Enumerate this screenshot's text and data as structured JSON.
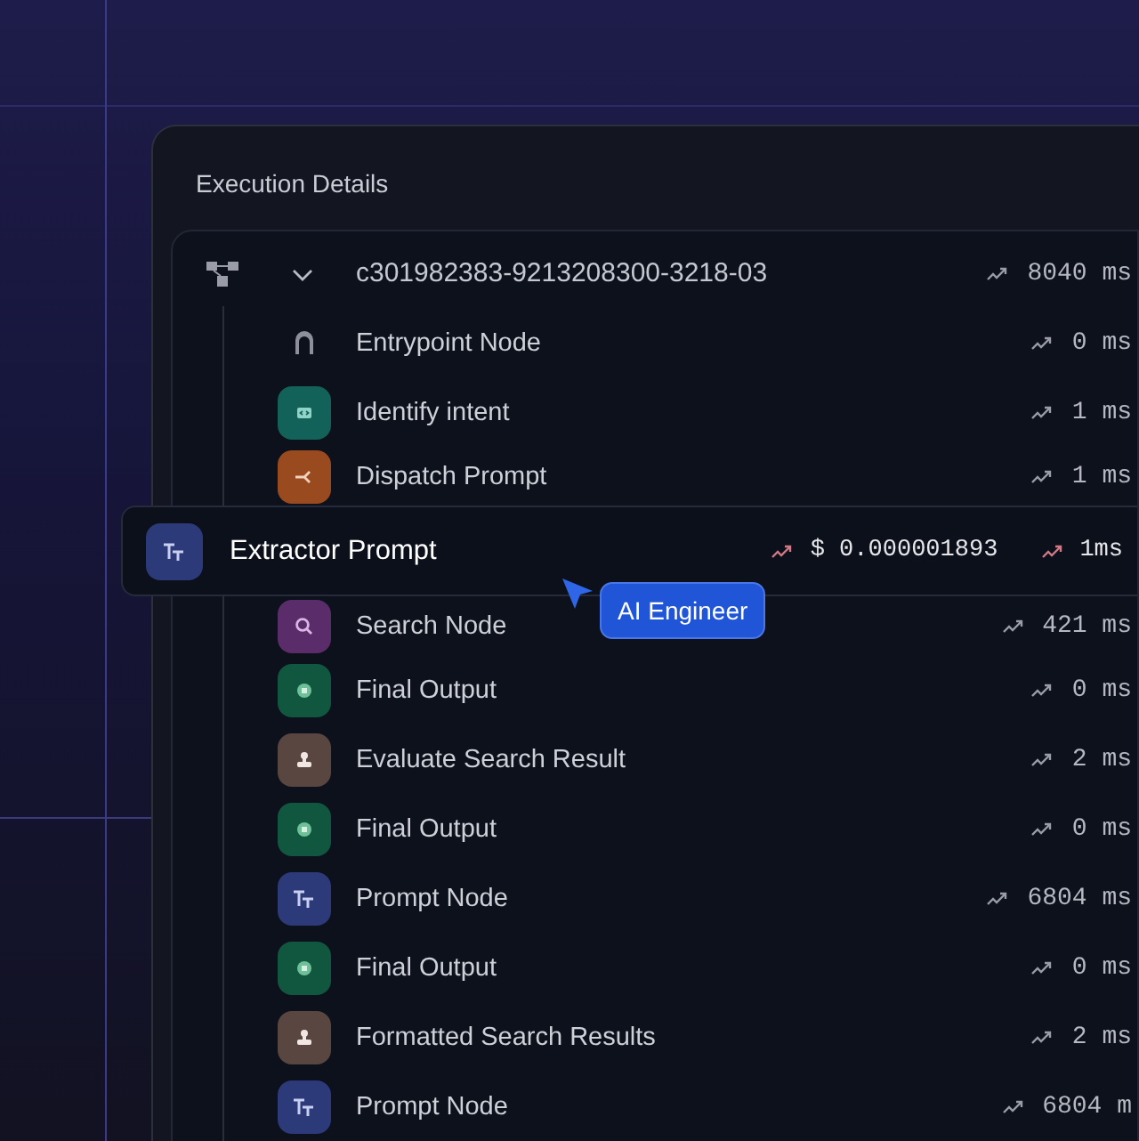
{
  "panel": {
    "title": "Execution Details"
  },
  "trace": {
    "id": "c301982383-9213208300-3218-03",
    "expanded": true,
    "time": "8040 ms"
  },
  "steps": [
    {
      "name": "Entrypoint Node",
      "kind": "entry",
      "time": "0 ms",
      "selected": false
    },
    {
      "name": "Identify intent",
      "kind": "code",
      "time": "1 ms",
      "selected": false
    },
    {
      "name": "Dispatch Prompt",
      "kind": "branch",
      "time": "1 ms",
      "selected": false
    },
    {
      "name": "Extractor Prompt",
      "kind": "text",
      "cost": "$ 0.000001893",
      "time": "1ms",
      "selected": true
    },
    {
      "name": "Search Node",
      "kind": "search",
      "time": "421 ms",
      "selected": false
    },
    {
      "name": "Final Output",
      "kind": "output",
      "time": "0 ms",
      "selected": false
    },
    {
      "name": "Evaluate Search Result",
      "kind": "stamp",
      "time": "2 ms",
      "selected": false
    },
    {
      "name": "Final Output",
      "kind": "output",
      "time": "0 ms",
      "selected": false
    },
    {
      "name": "Prompt Node",
      "kind": "text",
      "time": "6804 ms",
      "selected": false
    },
    {
      "name": "Final Output",
      "kind": "output",
      "time": "0 ms",
      "selected": false
    },
    {
      "name": "Formatted Search Results",
      "kind": "stamp",
      "time": "2 ms",
      "selected": false
    },
    {
      "name": "Prompt Node",
      "kind": "text",
      "time": "6804 m",
      "selected": false
    }
  ],
  "cursor_tooltip": {
    "label": "AI Engineer"
  }
}
